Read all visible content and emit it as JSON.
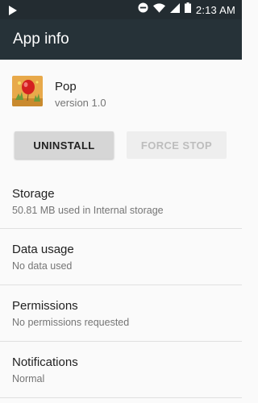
{
  "status_bar": {
    "time": "2:13 AM"
  },
  "app_bar": {
    "title": "App info"
  },
  "app": {
    "name": "Pop",
    "version": "version 1.0"
  },
  "buttons": {
    "uninstall": "UNINSTALL",
    "force_stop": "FORCE STOP"
  },
  "prefs": [
    {
      "title": "Storage",
      "summary": "50.81 MB used in Internal storage"
    },
    {
      "title": "Data usage",
      "summary": "No data used"
    },
    {
      "title": "Permissions",
      "summary": "No permissions requested"
    },
    {
      "title": "Notifications",
      "summary": "Normal"
    }
  ]
}
